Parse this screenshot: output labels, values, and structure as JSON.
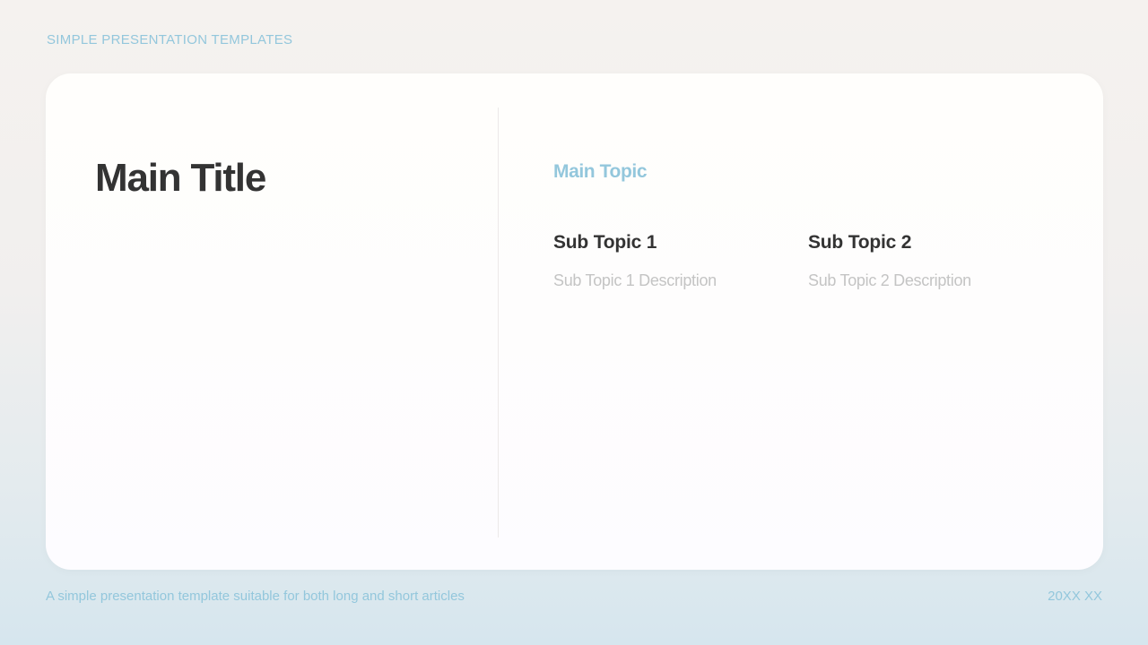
{
  "header": {
    "label": "SIMPLE PRESENTATION TEMPLATES"
  },
  "slide": {
    "main_title": "Main Title",
    "main_topic": "Main Topic",
    "sub_topics": [
      {
        "title": "Sub Topic 1",
        "description": "Sub Topic 1 Description"
      },
      {
        "title": "Sub Topic 2",
        "description": "Sub Topic 2 Description"
      }
    ]
  },
  "footer": {
    "description": "A simple presentation template suitable for both long and short articles",
    "date": "20XX  XX"
  },
  "colors": {
    "accent": "#93c7dc",
    "title_text": "#333333",
    "muted_text": "#c4c4c4"
  }
}
